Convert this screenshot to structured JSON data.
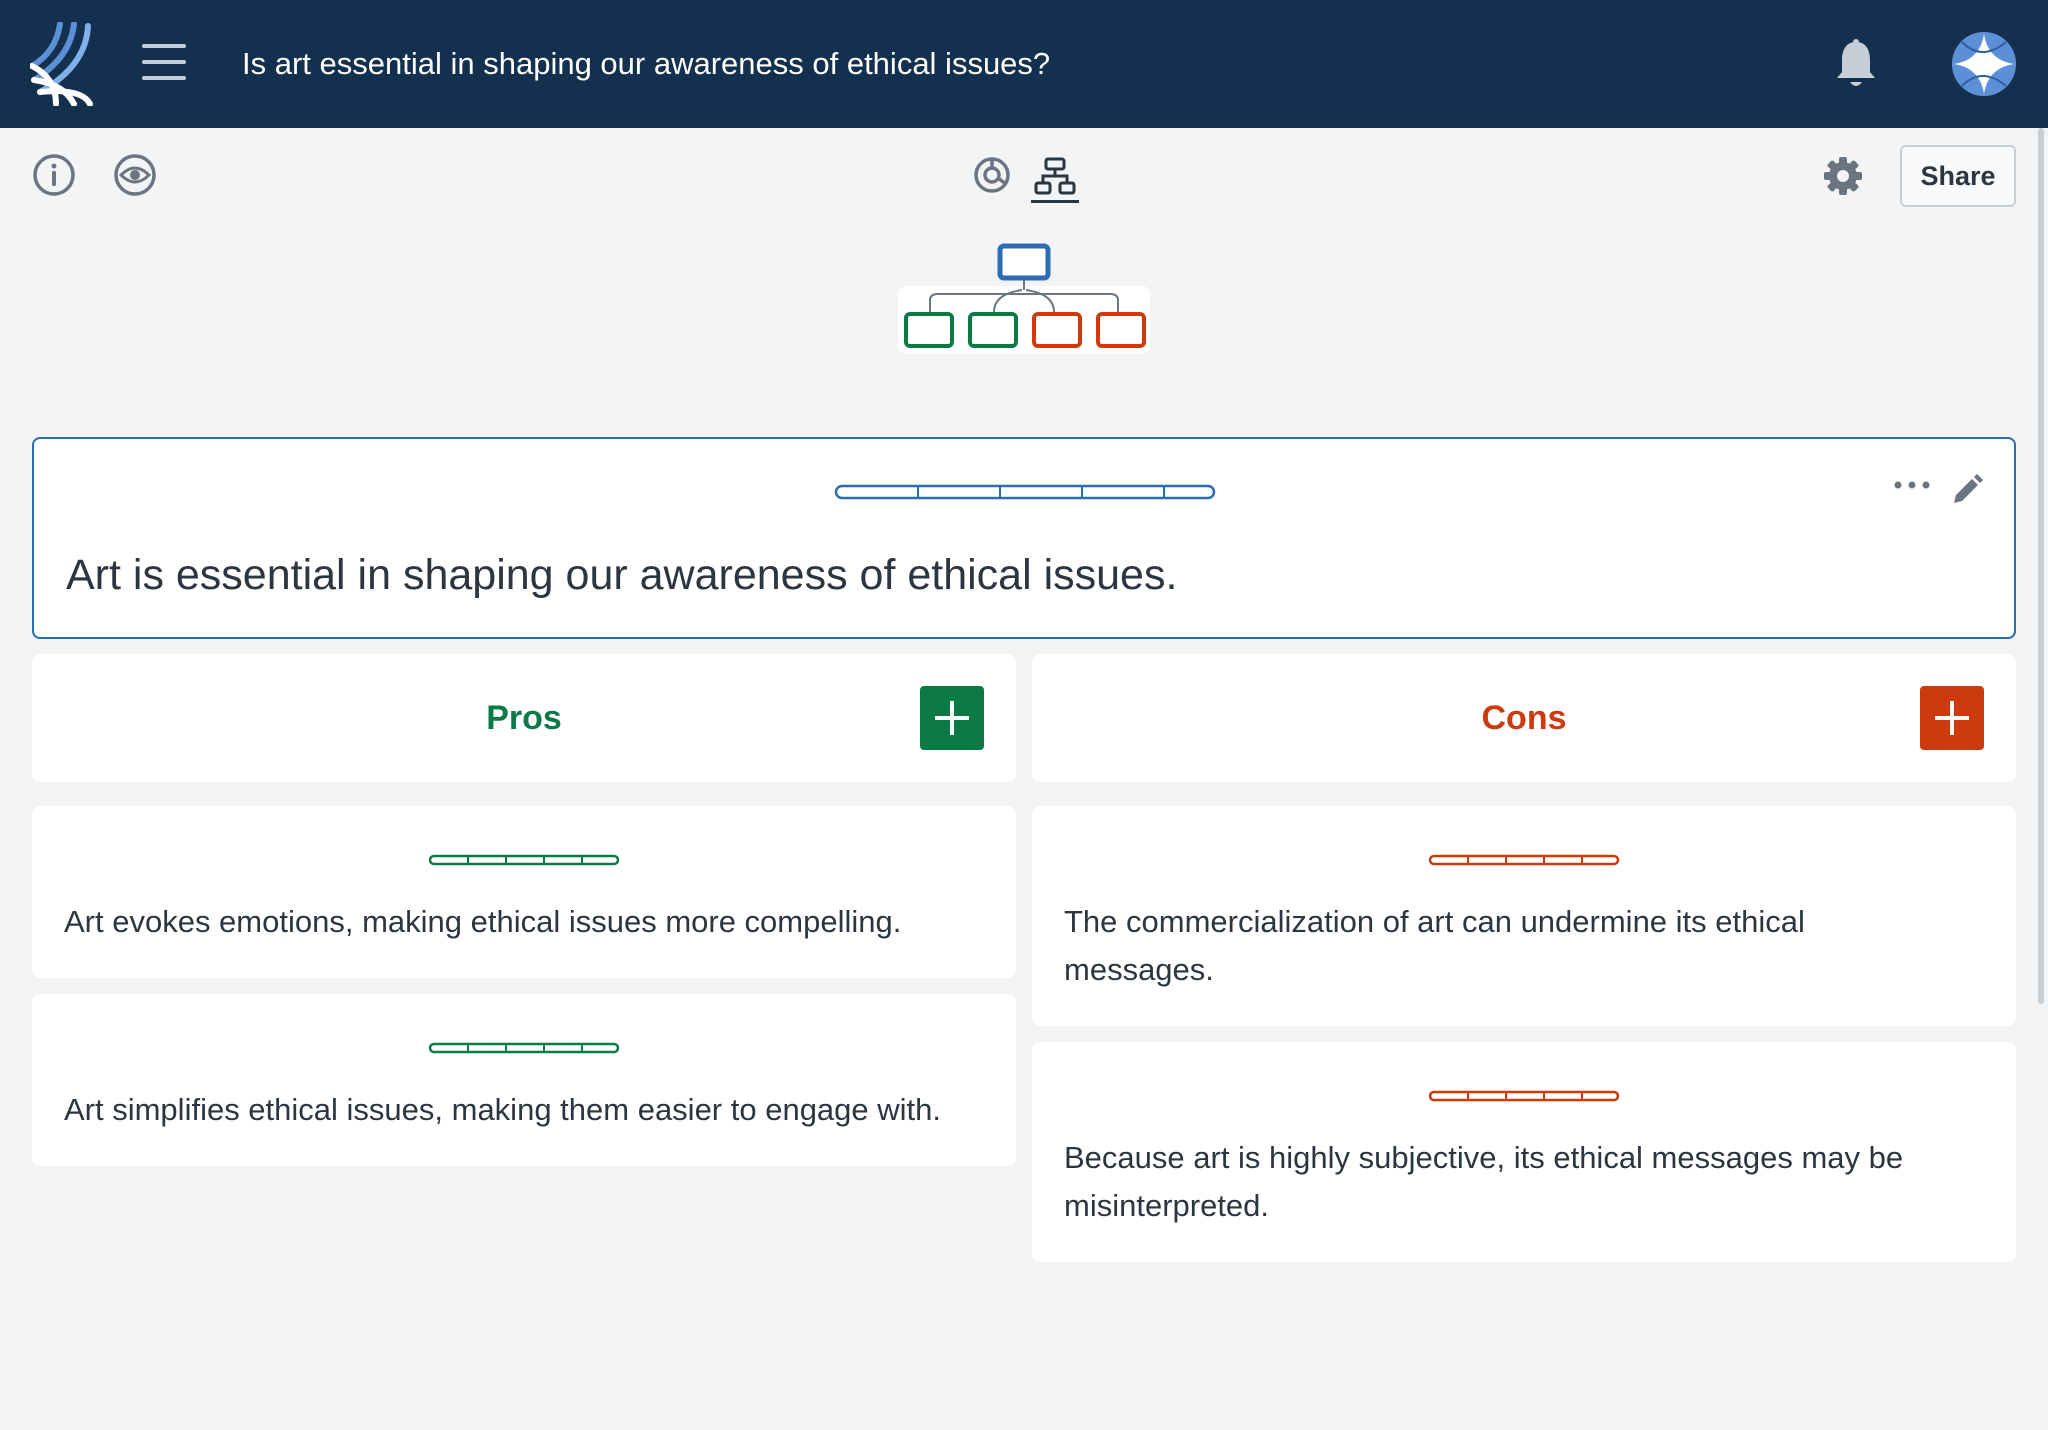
{
  "header": {
    "title": "Is art essential in shaping our awareness of ethical issues?",
    "logo_icon": "kialo-logo-icon",
    "menu_icon": "hamburger-icon",
    "notifications_icon": "bell-icon",
    "avatar_icon": "avatar-icon"
  },
  "toolbar": {
    "info_icon": "info-icon",
    "watch_icon": "eye-icon",
    "sunburst_icon": "sunburst-view-icon",
    "tree_icon": "tree-view-icon",
    "settings_icon": "gear-icon",
    "share_label": "Share"
  },
  "thesis": {
    "text": "Art is essential in shaping our awareness of ethical issues."
  },
  "columns": {
    "pros": {
      "label": "Pros",
      "color": "#0b7a45"
    },
    "cons": {
      "label": "Cons",
      "color": "#cc3a0e"
    }
  },
  "pros": [
    {
      "text": "Art evokes emotions, making ethical issues more compelling."
    },
    {
      "text": "Art simplifies ethical issues, making them easier to engage with."
    }
  ],
  "cons": [
    {
      "text": "The commercialization of art can undermine its ethical messages."
    },
    {
      "text": "Because art is highly subjective, its ethical messages may be misinterpreted."
    }
  ],
  "colors": {
    "header_bg": "#13304f",
    "accent_blue": "#2a6db5",
    "pro_green": "#0b7a45",
    "con_red": "#cc3a0e"
  }
}
